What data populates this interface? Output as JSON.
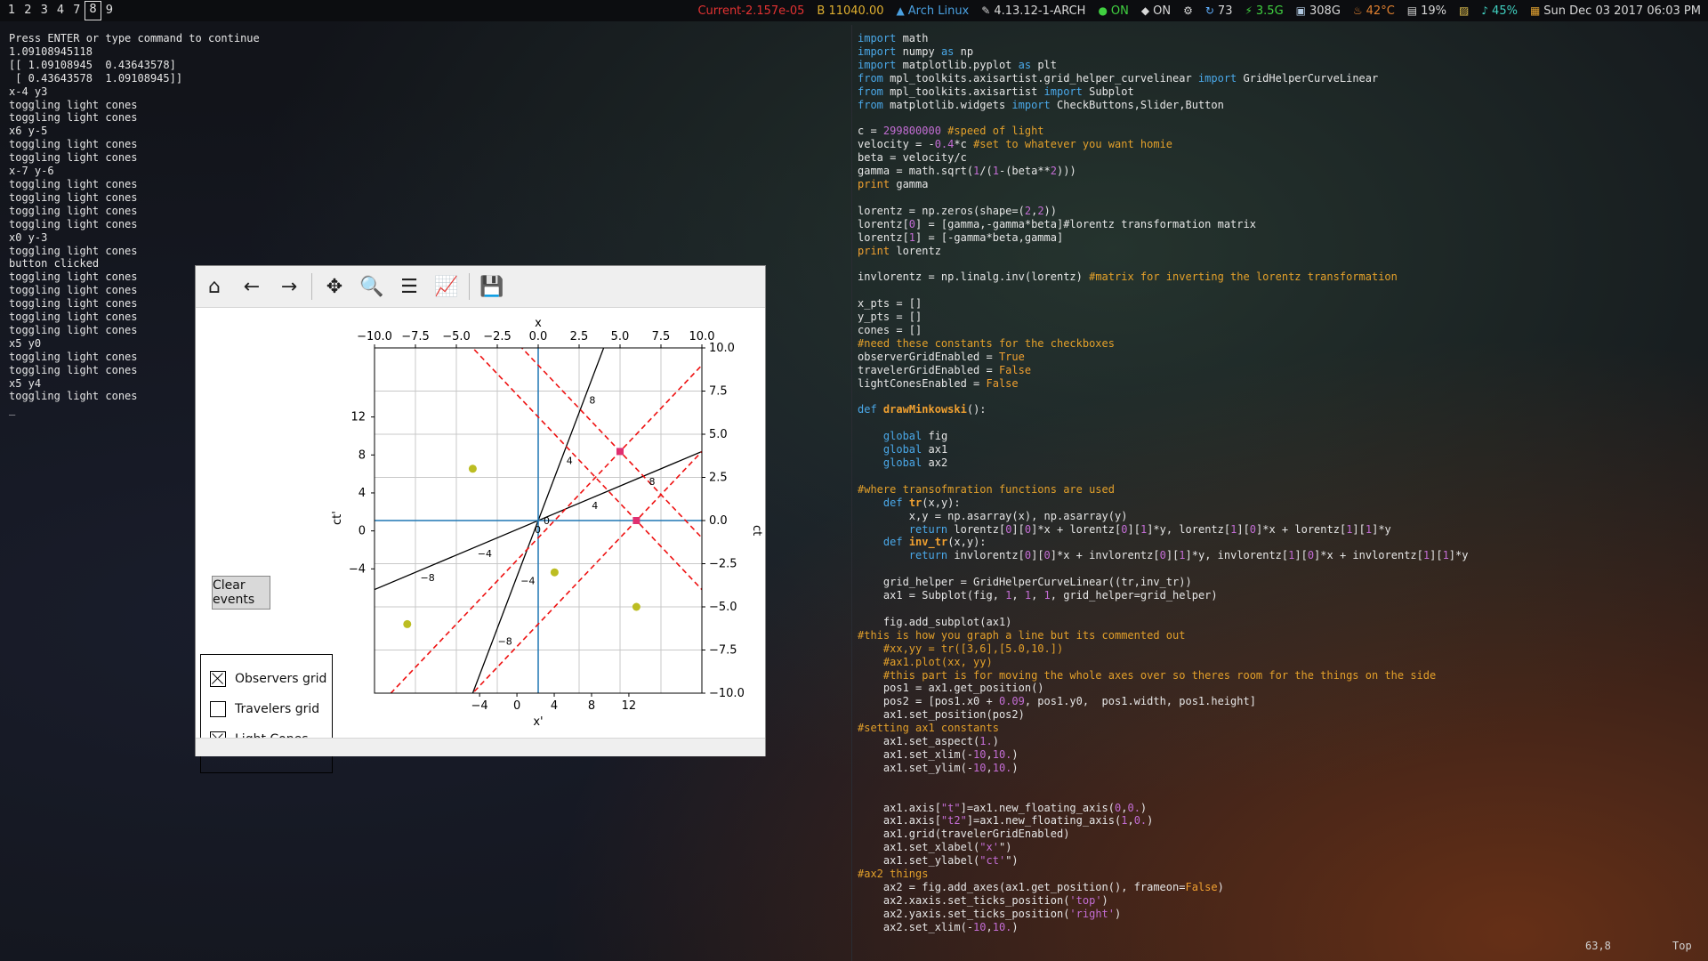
{
  "topbar": {
    "workspaces": [
      {
        "label": "1",
        "active": false
      },
      {
        "label": "2",
        "active": false
      },
      {
        "label": "3",
        "active": false
      },
      {
        "label": "4",
        "active": false
      },
      {
        "label": "7",
        "active": false
      },
      {
        "label": "8",
        "active": true
      },
      {
        "label": "9",
        "active": false
      }
    ],
    "status": {
      "current": "Current-2.157e-05",
      "battery_b": "B 11040.00",
      "distro": "Arch Linux",
      "kernel": "4.13.12-1-ARCH",
      "wifi_on": "ON",
      "vpn_on": "ON",
      "updates": "73",
      "mem": "3.5G",
      "disk": "308G",
      "temp": "42°C",
      "cpu": "19%",
      "volume": "45%",
      "clock": "Sun Dec 03 2017 06:03 PM"
    },
    "colors": {
      "current": "#e23232",
      "battery": "#e0b030",
      "distro": "#4aa0e0",
      "kernel": "#e0e0e0",
      "wifi": "#40d040",
      "updates": "#60b0ff",
      "mem": "#40d040",
      "disk": "#b0c8e0",
      "temp": "#e08030",
      "volume": "#40d0c0"
    }
  },
  "terminal_left": {
    "lines": [
      "Press ENTER or type command to continue",
      "1.09108945118",
      "[[ 1.09108945  0.43643578]",
      " [ 0.43643578  1.09108945]]",
      "x-4 y3",
      "toggling light cones",
      "toggling light cones",
      "x6 y-5",
      "toggling light cones",
      "toggling light cones",
      "x-7 y-6",
      "toggling light cones",
      "toggling light cones",
      "toggling light cones",
      "toggling light cones",
      "x0 y-3",
      "toggling light cones",
      "button clicked",
      "toggling light cones",
      "toggling light cones",
      "toggling light cones",
      "toggling light cones",
      "toggling light cones",
      "x5 y0",
      "toggling light cones",
      "toggling light cones",
      "x5 y4",
      "toggling light cones",
      "_"
    ]
  },
  "code": {
    "lines": [
      "import math",
      "import numpy as np",
      "import matplotlib.pyplot as plt",
      "from mpl_toolkits.axisartist.grid_helper_curvelinear import GridHelperCurveLinear",
      "from mpl_toolkits.axisartist import Subplot",
      "from matplotlib.widgets import CheckButtons,Slider,Button",
      "",
      "c = 299800000 #speed of light",
      "velocity = -0.4*c #set to whatever you want homie",
      "beta = velocity/c",
      "gamma = math.sqrt(1/(1-(beta**2)))",
      "print gamma",
      "",
      "lorentz = np.zeros(shape=(2,2))",
      "lorentz[0] = [gamma,-gamma*beta]#lorentz transformation matrix",
      "lorentz[1] = [-gamma*beta,gamma]",
      "print lorentz",
      "",
      "invlorentz = np.linalg.inv(lorentz) #matrix for inverting the lorentz transformation",
      "",
      "x_pts = []",
      "y_pts = []",
      "cones = []",
      "#need these constants for the checkboxes",
      "observerGridEnabled = True",
      "travelerGridEnabled = False",
      "lightConesEnabled = False",
      "",
      "def drawMinkowski():",
      "",
      "    global fig",
      "    global ax1",
      "    global ax2",
      "",
      "#where transofmration functions are used",
      "    def tr(x,y):",
      "        x,y = np.asarray(x), np.asarray(y)",
      "        return lorentz[0][0]*x + lorentz[0][1]*y, lorentz[1][0]*x + lorentz[1][1]*y",
      "    def inv_tr(x,y):",
      "        return invlorentz[0][0]*x + invlorentz[0][1]*y, invlorentz[1][0]*x + invlorentz[1][1]*y",
      "",
      "    grid_helper = GridHelperCurveLinear((tr,inv_tr))",
      "    ax1 = Subplot(fig, 1, 1, 1, grid_helper=grid_helper)",
      "",
      "    fig.add_subplot(ax1)",
      "#this is how you graph a line but its commented out",
      "    #xx,yy = tr([3,6],[5.0,10.])",
      "    #ax1.plot(xx, yy)",
      "    #this part is for moving the whole axes over so theres room for the things on the side",
      "    pos1 = ax1.get_position()",
      "    pos2 = [pos1.x0 + 0.09, pos1.y0,  pos1.width, pos1.height]",
      "    ax1.set_position(pos2)",
      "#setting ax1 constants",
      "    ax1.set_aspect(1.)",
      "    ax1.set_xlim(-10,10.)",
      "    ax1.set_ylim(-10,10.)",
      "",
      "",
      "    ax1.axis[\"t\"]=ax1.new_floating_axis(0,0.)",
      "    ax1.axis[\"t2\"]=ax1.new_floating_axis(1,0.)",
      "    ax1.grid(travelerGridEnabled)",
      "    ax1.set_xlabel(\"x'\")",
      "    ax1.set_ylabel(\"ct'\")",
      "#ax2 things",
      "    ax2 = fig.add_axes(ax1.get_position(), frameon=False)",
      "    ax2.xaxis.set_ticks_position('top')",
      "    ax2.yaxis.set_ticks_position('right')",
      "    ax2.set_xlim(-10,10.)"
    ],
    "vim_position": "63,8",
    "vim_scroll": "Top"
  },
  "figure": {
    "toolbar": [
      {
        "name": "home-icon",
        "glyph": "⌂"
      },
      {
        "name": "back-arrow-icon",
        "glyph": "←"
      },
      {
        "name": "forward-arrow-icon",
        "glyph": "→"
      },
      {
        "name": "pan-icon",
        "glyph": "✥"
      },
      {
        "name": "zoom-icon",
        "glyph": "🔍"
      },
      {
        "name": "configure-subplots-icon",
        "glyph": "☰"
      },
      {
        "name": "edit-axes-icon",
        "glyph": "📈"
      },
      {
        "name": "save-icon",
        "glyph": "💾"
      }
    ],
    "clear_button": "Clear events",
    "checkboxes": [
      {
        "label": "Observers grid",
        "checked": true
      },
      {
        "label": "Travelers grid",
        "checked": false
      },
      {
        "label": "Light Cones",
        "checked": true
      }
    ]
  },
  "chart_data": {
    "type": "scatter",
    "top_axis": {
      "label": "x",
      "ticks": [
        "−10.0",
        "−7.5",
        "−5.0",
        "−2.5",
        "0.0",
        "2.5",
        "5.0",
        "7.5",
        "10.0"
      ],
      "range": [
        -10,
        10
      ]
    },
    "right_axis": {
      "label": "ct",
      "ticks": [
        "10.0",
        "7.5",
        "5.0",
        "2.5",
        "0.0",
        "−2.5",
        "−5.0",
        "−7.5",
        "−10.0"
      ],
      "range": [
        -10,
        10
      ]
    },
    "bottom_axis": {
      "label": "x'",
      "ticks": [
        "−4",
        "0",
        "4",
        "8",
        "12"
      ]
    },
    "left_axis": {
      "label": "ct'",
      "ticks": [
        "12",
        "8",
        "4",
        "0",
        "−4"
      ]
    },
    "boost_axis_labels": [
      "8",
      "4",
      "0",
      "−4",
      "−8"
    ],
    "grid": true,
    "points": [
      {
        "x": -4,
        "y": 3
      },
      {
        "x": 6,
        "y": -5
      },
      {
        "x": -8,
        "y": -6
      },
      {
        "x": 1,
        "y": -3
      }
    ],
    "light_cones": [
      {
        "x": 5,
        "y": 4
      },
      {
        "x": 6,
        "y": 0
      }
    ],
    "colors": {
      "grid": "#c8c8c8",
      "axes": "#1f77b4",
      "cones": "#ee1111",
      "points": "#bcbd22",
      "events": "#e03070"
    }
  }
}
